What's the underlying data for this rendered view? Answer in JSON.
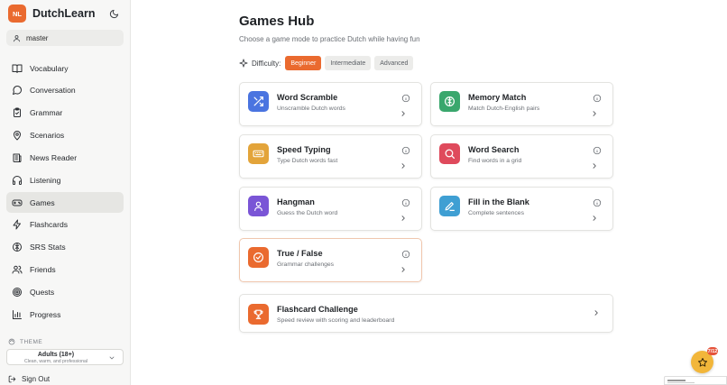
{
  "brand": {
    "logo": "NL",
    "name": "DutchLearn",
    "toggle_icon": "moon-icon"
  },
  "user": {
    "name": "master",
    "icon": "user-icon"
  },
  "nav": [
    {
      "label": "Vocabulary",
      "icon": "book-open-icon",
      "active": false
    },
    {
      "label": "Conversation",
      "icon": "message-circle-icon",
      "active": false
    },
    {
      "label": "Grammar",
      "icon": "clipboard-check-icon",
      "active": false
    },
    {
      "label": "Scenarios",
      "icon": "map-pin-icon",
      "active": false
    },
    {
      "label": "News Reader",
      "icon": "newspaper-icon",
      "active": false
    },
    {
      "label": "Listening",
      "icon": "headphones-icon",
      "active": false
    },
    {
      "label": "Games",
      "icon": "gamepad-icon",
      "active": true
    },
    {
      "label": "Flashcards",
      "icon": "zap-icon",
      "active": false
    },
    {
      "label": "SRS Stats",
      "icon": "brain-icon",
      "active": false
    },
    {
      "label": "Friends",
      "icon": "users-icon",
      "active": false
    },
    {
      "label": "Quests",
      "icon": "target-icon",
      "active": false
    },
    {
      "label": "Progress",
      "icon": "bar-chart-icon",
      "active": false
    }
  ],
  "theme": {
    "label": "THEME",
    "selected": "Adults (18+)",
    "selected_desc": "Clean, warm, and professional"
  },
  "signout": {
    "label": "Sign Out"
  },
  "page": {
    "title": "Games Hub",
    "subtitle": "Choose a game mode to practice Dutch while having fun"
  },
  "difficulty": {
    "label": "Difficulty:",
    "options": [
      "Beginner",
      "Intermediate",
      "Advanced"
    ],
    "selected": "Beginner"
  },
  "games": [
    {
      "title": "Word Scramble",
      "desc": "Unscramble Dutch words",
      "icon": "shuffle-icon",
      "color": "#4a74e0"
    },
    {
      "title": "Memory Match",
      "desc": "Match Dutch-English pairs",
      "icon": "brain-icon",
      "color": "#3aa76d"
    },
    {
      "title": "Speed Typing",
      "desc": "Type Dutch words fast",
      "icon": "keyboard-icon",
      "color": "#e3a43a"
    },
    {
      "title": "Word Search",
      "desc": "Find words in a grid",
      "icon": "search-icon",
      "color": "#df4a5c"
    },
    {
      "title": "Hangman",
      "desc": "Guess the Dutch word",
      "icon": "user-icon",
      "color": "#7a55d6"
    },
    {
      "title": "Fill in the Blank",
      "desc": "Complete sentences",
      "icon": "pencil-icon",
      "color": "#3f9fd3"
    },
    {
      "title": "True / False",
      "desc": "Grammar challenges",
      "icon": "check-circle-icon",
      "color": "#ea6a2f"
    }
  ],
  "challenge": {
    "title": "Flashcard Challenge",
    "desc": "Speed review with scoring and leaderboard",
    "icon": "trophy-icon",
    "color": "#ea6a2f"
  },
  "fab": {
    "icon": "star-icon",
    "badge": "7/12"
  },
  "colors": {
    "accent": "#ea6a2f",
    "sidebar_bg": "#f7f7f6",
    "active_nav": "#e6e6e3"
  }
}
